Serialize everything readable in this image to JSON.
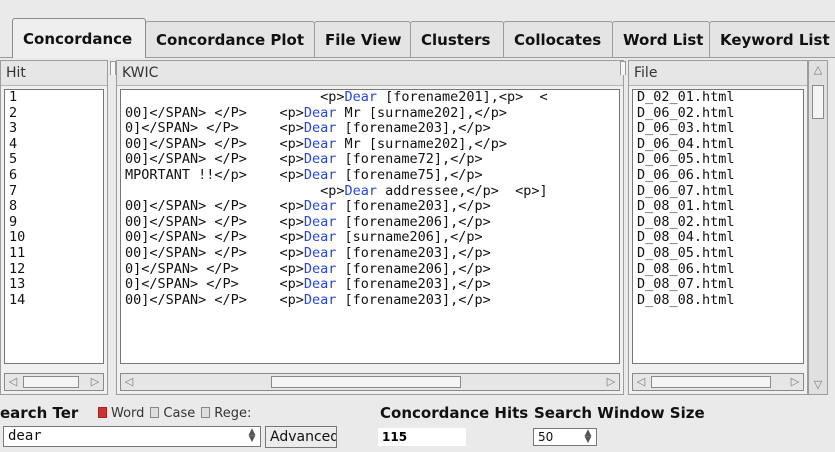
{
  "tabs": [
    {
      "label": "Concordance",
      "active": true
    },
    {
      "label": "Concordance Plot"
    },
    {
      "label": "File View"
    },
    {
      "label": "Clusters"
    },
    {
      "label": "Collocates"
    },
    {
      "label": "Word List"
    },
    {
      "label": "Keyword List"
    }
  ],
  "panels": {
    "hit_header": "Hit",
    "kwic_header": "KWIC",
    "file_header": "File"
  },
  "rows": [
    {
      "hit": "1",
      "left": "                        ",
      "node": "Dear",
      "right": " [forename201],<p>  <"
    },
    {
      "hit": "2",
      "left": "00]</SPAN> </P>    ",
      "node": "Dear",
      "right": " Mr [surname202],</p>"
    },
    {
      "hit": "3",
      "left": "0]</SPAN> </P>     ",
      "node": "Dear",
      "right": " [forename203],</p>"
    },
    {
      "hit": "4",
      "left": "00]</SPAN> </P>    ",
      "node": "Dear",
      "right": " Mr [surname202],</p>"
    },
    {
      "hit": "5",
      "left": "00]</SPAN> </P>    ",
      "node": "Dear",
      "right": " [forename72],</p>"
    },
    {
      "hit": "6",
      "left": "MPORTANT !!</p>    ",
      "node": "Dear",
      "right": " [forename75],</p>"
    },
    {
      "hit": "7",
      "left": "                        ",
      "node": "Dear",
      "right": " addressee,</p>  <p>]"
    },
    {
      "hit": "8",
      "left": "00]</SPAN> </P>    ",
      "node": "Dear",
      "right": " [forename203],</p>"
    },
    {
      "hit": "9",
      "left": "00]</SPAN> </P>    ",
      "node": "Dear",
      "right": " [forename206],</p>"
    },
    {
      "hit": "10",
      "left": "00]</SPAN> </P>    ",
      "node": "Dear",
      "right": " [surname206],</p>"
    },
    {
      "hit": "11",
      "left": "00]</SPAN> </P>    ",
      "node": "Dear",
      "right": " [forename203],</p>"
    },
    {
      "hit": "12",
      "left": "0]</SPAN> </P>     ",
      "node": "Dear",
      "right": " [forename206],</p>"
    },
    {
      "hit": "13",
      "left": "0]</SPAN> </P>     ",
      "node": "Dear",
      "right": " [forename203],</p>"
    },
    {
      "hit": "14",
      "left": "00]</SPAN> </P>    ",
      "node": "Dear",
      "right": " [forename203],</p>"
    }
  ],
  "tag_open": "<p>",
  "files": [
    "D_02_01.html",
    "D_06_02.html",
    "D_06_03.html",
    "D_06_04.html",
    "D_06_05.html",
    "D_06_06.html",
    "D_06_07.html",
    "D_08_01.html",
    "D_08_02.html",
    "D_08_04.html",
    "D_08_05.html",
    "D_08_06.html",
    "D_08_07.html",
    "D_08_08.html"
  ],
  "search": {
    "term_label": "earch Ter",
    "word_label": "Word",
    "case_label": "Case",
    "regex_label": "Rege:",
    "query": "dear",
    "advanced_label": "Advanced"
  },
  "hits": {
    "label": "Concordance Hits",
    "value": "115"
  },
  "window": {
    "label": "Search Window Size",
    "value": "50"
  }
}
